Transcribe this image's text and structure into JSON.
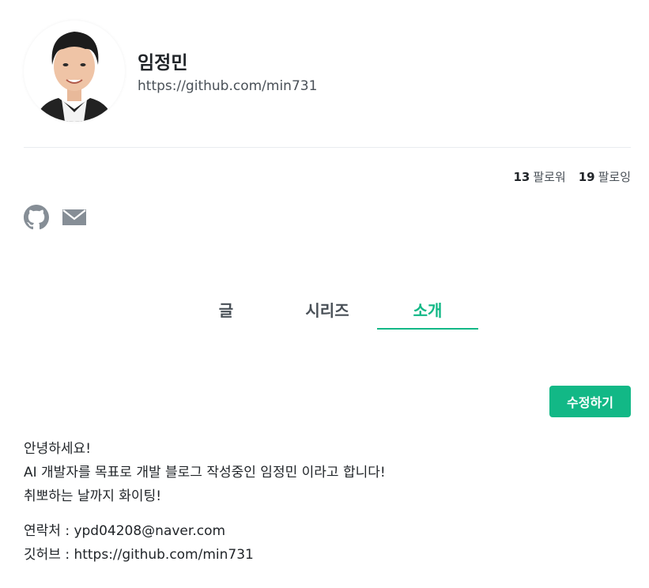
{
  "profile": {
    "name": "임정민",
    "url": "https://github.com/min731"
  },
  "follow": {
    "followers_count": "13",
    "followers_label": "팔로워",
    "following_count": "19",
    "following_label": "팔로잉"
  },
  "social": {
    "icons": [
      "github-icon",
      "mail-icon"
    ]
  },
  "tabs": [
    {
      "label": "글",
      "active": false
    },
    {
      "label": "시리즈",
      "active": false
    },
    {
      "label": "소개",
      "active": true
    }
  ],
  "about": {
    "edit_label": "수정하기",
    "lines": [
      "안녕하세요!",
      "AI 개발자를 목표로 개발 블로그 작성중인 임정민 이라고 합니다!",
      "취뽀하는 날까지 화이팅!"
    ],
    "contacts": [
      "연락처 : ypd04208@naver.com",
      "깃허브 : https://github.com/min731"
    ]
  },
  "colors": {
    "accent": "#12b886",
    "text": "#212529",
    "muted": "#495057",
    "icon": "#868e96"
  }
}
